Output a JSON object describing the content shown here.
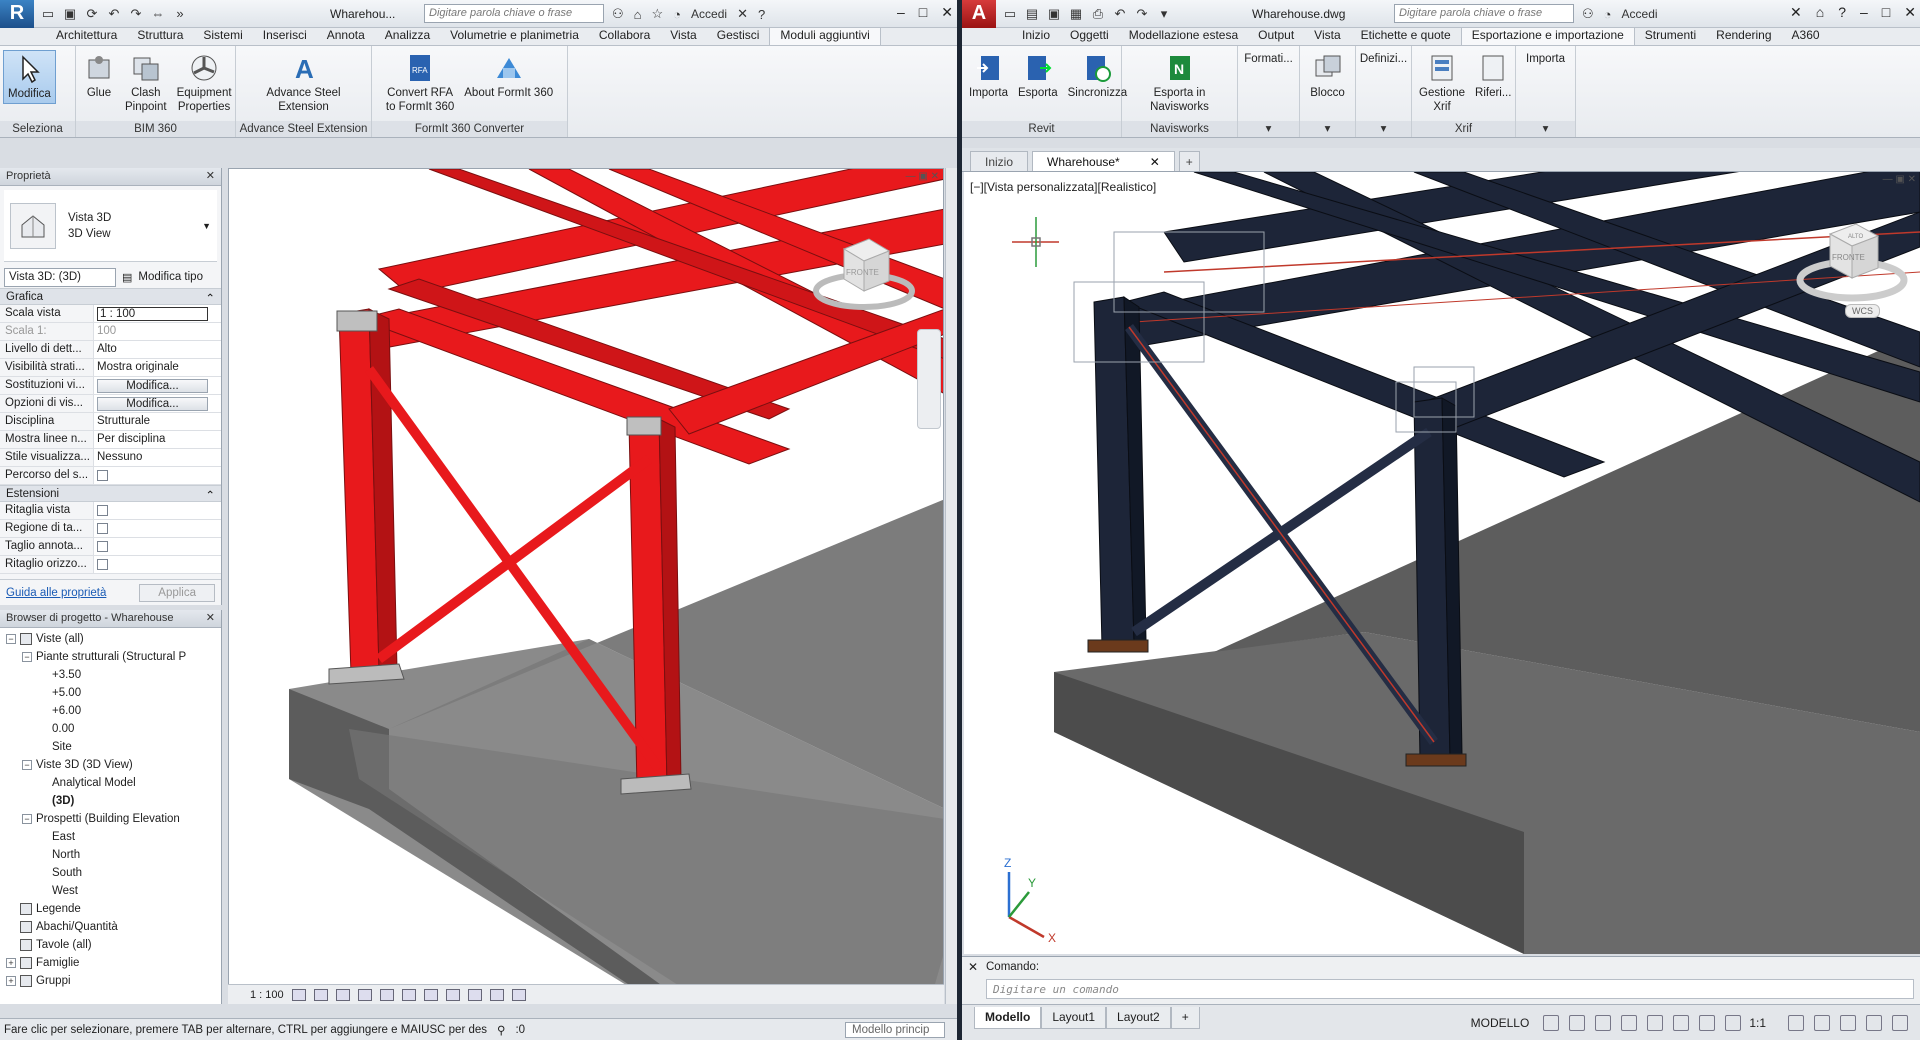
{
  "revit": {
    "app_letter": "R",
    "doc_title": "Wharehou...",
    "search_placeholder": "Digitare parola chiave o frase",
    "signin": "Accedi",
    "tabs": [
      "Architettura",
      "Struttura",
      "Sistemi",
      "Inserisci",
      "Annota",
      "Analizza",
      "Volumetrie e planimetria",
      "Collabora",
      "Vista",
      "Gestisci",
      "Moduli aggiuntivi"
    ],
    "active_tab": "Moduli aggiuntivi",
    "panels": [
      {
        "title": "Seleziona",
        "buttons": [
          "Modifica"
        ]
      },
      {
        "title": "BIM 360",
        "buttons": [
          "Glue",
          "Clash\nPinpoint",
          "Equipment\nProperties"
        ]
      },
      {
        "title": "Advance Steel Extension",
        "buttons": [
          "Advance Steel\nExtension"
        ]
      },
      {
        "title": "FormIt 360 Converter",
        "buttons": [
          "Convert RFA\nto FormIt 360",
          "About FormIt 360"
        ]
      }
    ],
    "properties": {
      "header": "Proprietà",
      "type_name": "Vista 3D",
      "type_sub": "3D View",
      "selector": "Vista 3D: (3D)",
      "edit_type": "Modifica tipo",
      "group_graphics": "Grafica",
      "rows": [
        {
          "k": "Scala vista",
          "v": "1 : 100",
          "kind": "edit"
        },
        {
          "k": "Scala 1:",
          "v": "100",
          "kind": "dim"
        },
        {
          "k": "Livello di dett...",
          "v": "Alto",
          "kind": "text"
        },
        {
          "k": "Visibilità strati...",
          "v": "Mostra originale",
          "kind": "text"
        },
        {
          "k": "Sostituzioni vi...",
          "v": "Modifica...",
          "kind": "button"
        },
        {
          "k": "Opzioni di vis...",
          "v": "Modifica...",
          "kind": "button"
        },
        {
          "k": "Disciplina",
          "v": "Strutturale",
          "kind": "text"
        },
        {
          "k": "Mostra linee n...",
          "v": "Per disciplina",
          "kind": "text"
        },
        {
          "k": "Stile visualizza...",
          "v": "Nessuno",
          "kind": "text"
        },
        {
          "k": "Percorso del s...",
          "v": "",
          "kind": "check"
        }
      ],
      "group_extents": "Estensioni",
      "rows2": [
        {
          "k": "Ritaglia vista",
          "v": "",
          "kind": "check"
        },
        {
          "k": "Regione di ta...",
          "v": "",
          "kind": "check"
        },
        {
          "k": "Taglio annota...",
          "v": "",
          "kind": "check"
        },
        {
          "k": "Ritaglio orizzo...",
          "v": "",
          "kind": "check"
        }
      ],
      "help_link": "Guida alle proprietà",
      "apply": "Applica"
    },
    "browser": {
      "header": "Browser di progetto - Wharehouse",
      "items": [
        {
          "label": "Viste (all)",
          "level": 0,
          "tog": "−",
          "icon": true
        },
        {
          "label": "Piante strutturali (Structural P",
          "level": 1,
          "tog": "−"
        },
        {
          "label": "+3.50",
          "level": 2
        },
        {
          "label": "+5.00",
          "level": 2
        },
        {
          "label": "+6.00",
          "level": 2
        },
        {
          "label": "0.00",
          "level": 2
        },
        {
          "label": "Site",
          "level": 2
        },
        {
          "label": "Viste 3D (3D View)",
          "level": 1,
          "tog": "−"
        },
        {
          "label": "Analytical Model",
          "level": 2
        },
        {
          "label": "(3D)",
          "level": 2,
          "bold": true
        },
        {
          "label": "Prospetti (Building Elevation",
          "level": 1,
          "tog": "−"
        },
        {
          "label": "East",
          "level": 2
        },
        {
          "label": "North",
          "level": 2
        },
        {
          "label": "South",
          "level": 2
        },
        {
          "label": "West",
          "level": 2
        },
        {
          "label": "Legende",
          "level": 0,
          "icon": true
        },
        {
          "label": "Abachi/Quantità",
          "level": 0,
          "icon": true
        },
        {
          "label": "Tavole (all)",
          "level": 0,
          "icon": true
        },
        {
          "label": "Famiglie",
          "level": 0,
          "tog": "+",
          "icon": true
        },
        {
          "label": "Gruppi",
          "level": 0,
          "tog": "+",
          "icon": true
        }
      ]
    },
    "view_scale": "1 : 100",
    "status": "Fare clic per selezionare, premere TAB per alternare, CTRL per aggiungere e MAIUSC per des",
    "status_zero": ":0",
    "model_box": "Modello princip",
    "viewcube_label": "FRONTE",
    "steel_color": "#e8191c"
  },
  "acad": {
    "app_letter": "A",
    "doc_title": "Wharehouse.dwg",
    "search_placeholder": "Digitare parola chiave o frase",
    "signin": "Accedi",
    "tabs": [
      "Inizio",
      "Oggetti",
      "Modellazione estesa",
      "Output",
      "Vista",
      "Etichette e quote",
      "Esportazione e importazione",
      "Strumenti",
      "Rendering",
      "A360"
    ],
    "active_tab": "Esportazione e importazione",
    "panels": [
      {
        "title": "Revit",
        "buttons": [
          "Importa",
          "Esporta",
          "Sincronizza"
        ]
      },
      {
        "title": "Navisworks",
        "buttons": [
          "Esporta in Navisworks"
        ]
      },
      {
        "title": "",
        "buttons": [
          "Formati..."
        ]
      },
      {
        "title": "",
        "buttons": [
          "Blocco"
        ]
      },
      {
        "title": "",
        "buttons": [
          "Definizi..."
        ]
      },
      {
        "title": "Xrif",
        "buttons": [
          "Gestione\nXrif",
          "Riferi..."
        ]
      },
      {
        "title": "",
        "buttons": [
          "Importa"
        ]
      }
    ],
    "doc_tabs": [
      "Inizio",
      "Wharehouse*"
    ],
    "viewport_label": "[−][Vista personalizzata][Realistico]",
    "viewcube_label": "FRONTE",
    "viewcube_top": "ALTO",
    "wcs": "WCS",
    "cmd_history": "Comando:",
    "cmd_placeholder": "Digitare un comando",
    "layout_tabs": [
      "Modello",
      "Layout1",
      "Layout2"
    ],
    "model_label": "MODELLO",
    "scale": "1:1",
    "steel_color": "#1d2538"
  }
}
